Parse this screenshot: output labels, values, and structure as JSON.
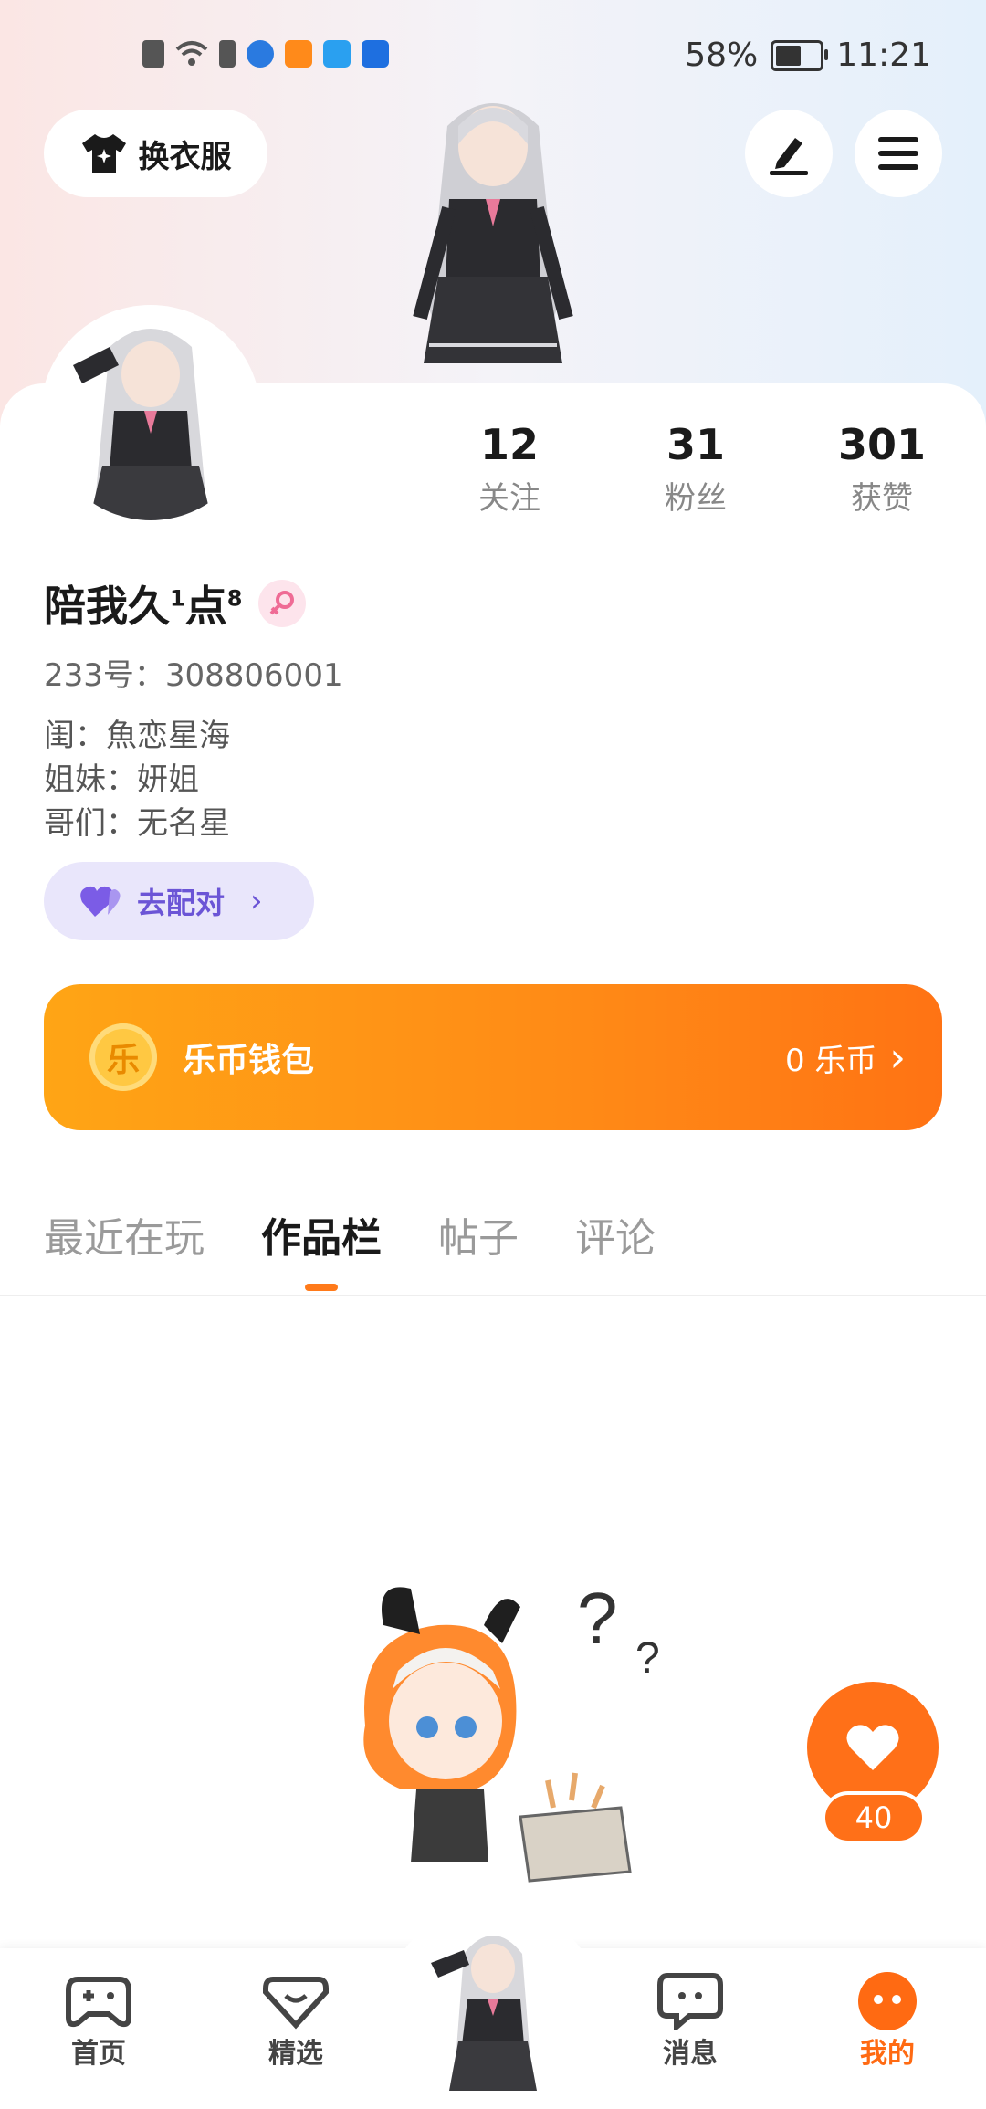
{
  "status_bar": {
    "battery": "58%",
    "battery_level": 0.58,
    "time": "11:21"
  },
  "header": {
    "outfit_label": "换衣服"
  },
  "stats": [
    {
      "value": "12",
      "label": "关注"
    },
    {
      "value": "31",
      "label": "粉丝"
    },
    {
      "value": "301",
      "label": "获赞"
    }
  ],
  "profile": {
    "name": "陪我久",
    "name_sup1": "1",
    "name_mid": "点",
    "name_sup2": "8",
    "id_line": "233号：308806001",
    "relations": [
      "闺：魚恋星海",
      "姐妹：妍姐",
      "哥们：无名星"
    ]
  },
  "pair_button": {
    "label": "去配对"
  },
  "wallet": {
    "coin_glyph": "乐",
    "title": "乐币钱包",
    "balance": "0 乐币"
  },
  "tabs": [
    {
      "label": "最近在玩",
      "active": false
    },
    {
      "label": "作品栏",
      "active": true
    },
    {
      "label": "帖子",
      "active": false
    },
    {
      "label": "评论",
      "active": false
    }
  ],
  "like_fab": {
    "count": "40"
  },
  "nav": [
    {
      "label": "首页",
      "icon": "gamepad-icon",
      "active": false
    },
    {
      "label": "精选",
      "icon": "heart-outline-icon",
      "active": false
    },
    {
      "label": "消息",
      "icon": "chat-icon",
      "active": false
    },
    {
      "label": "我的",
      "icon": "profile-icon",
      "active": true
    }
  ],
  "colors": {
    "accent": "#ff7018",
    "pair_bg": "#e9e6fb",
    "pair_text": "#6b55d6",
    "wallet_start": "#ffa515",
    "wallet_end": "#ff7314"
  }
}
